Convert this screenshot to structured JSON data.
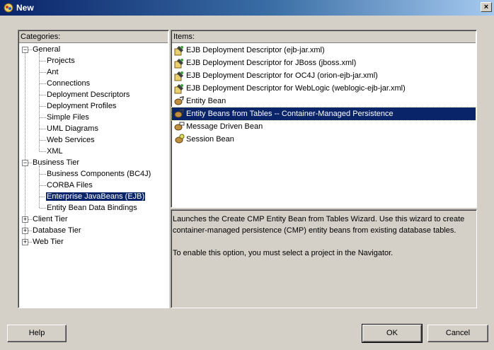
{
  "window": {
    "title": "New"
  },
  "categories": {
    "header": "Categories:",
    "tree": [
      {
        "label": "General",
        "level": 0,
        "expander": "minus"
      },
      {
        "label": "Projects",
        "level": 1
      },
      {
        "label": "Ant",
        "level": 1
      },
      {
        "label": "Connections",
        "level": 1
      },
      {
        "label": "Deployment Descriptors",
        "level": 1
      },
      {
        "label": "Deployment Profiles",
        "level": 1
      },
      {
        "label": "Simple Files",
        "level": 1
      },
      {
        "label": "UML Diagrams",
        "level": 1
      },
      {
        "label": "Web Services",
        "level": 1
      },
      {
        "label": "XML",
        "level": 1
      },
      {
        "label": "Business Tier",
        "level": 0,
        "expander": "minus"
      },
      {
        "label": "Business Components (BC4J)",
        "level": 1
      },
      {
        "label": "CORBA Files",
        "level": 1
      },
      {
        "label": "Enterprise JavaBeans (EJB)",
        "level": 1,
        "selected": true
      },
      {
        "label": "Entity Bean Data Bindings",
        "level": 1
      },
      {
        "label": "Client Tier",
        "level": 0,
        "expander": "plus"
      },
      {
        "label": "Database Tier",
        "level": 0,
        "expander": "plus"
      },
      {
        "label": "Web Tier",
        "level": 0,
        "expander": "plus"
      }
    ]
  },
  "items": {
    "header": "Items:",
    "list": [
      {
        "label": "EJB Deployment Descriptor (ejb-jar.xml)",
        "icon": "descriptor-icon"
      },
      {
        "label": "EJB Deployment Descriptor for JBoss (jboss.xml)",
        "icon": "descriptor-icon"
      },
      {
        "label": "EJB Deployment Descriptor for OC4J (orion-ejb-jar.xml)",
        "icon": "descriptor-icon"
      },
      {
        "label": "EJB Deployment Descriptor for WebLogic (weblogic-ejb-jar.xml)",
        "icon": "descriptor-icon"
      },
      {
        "label": "Entity Bean",
        "icon": "entity-bean-icon"
      },
      {
        "label": "Entity Beans from Tables -- Container-Managed Persistence",
        "icon": "entity-bean-icon",
        "selected": true
      },
      {
        "label": "Message Driven Bean",
        "icon": "message-bean-icon"
      },
      {
        "label": "Session Bean",
        "icon": "session-bean-icon"
      }
    ]
  },
  "description": {
    "paragraph1": "Launches the Create CMP Entity Bean from Tables Wizard.  Use this wizard to create container-managed persistence (CMP) entity beans from existing database tables.",
    "paragraph2": "To enable this option, you must select a project in the Navigator."
  },
  "buttons": {
    "help": "Help",
    "ok": "OK",
    "cancel": "Cancel"
  },
  "close_symbol": "×"
}
